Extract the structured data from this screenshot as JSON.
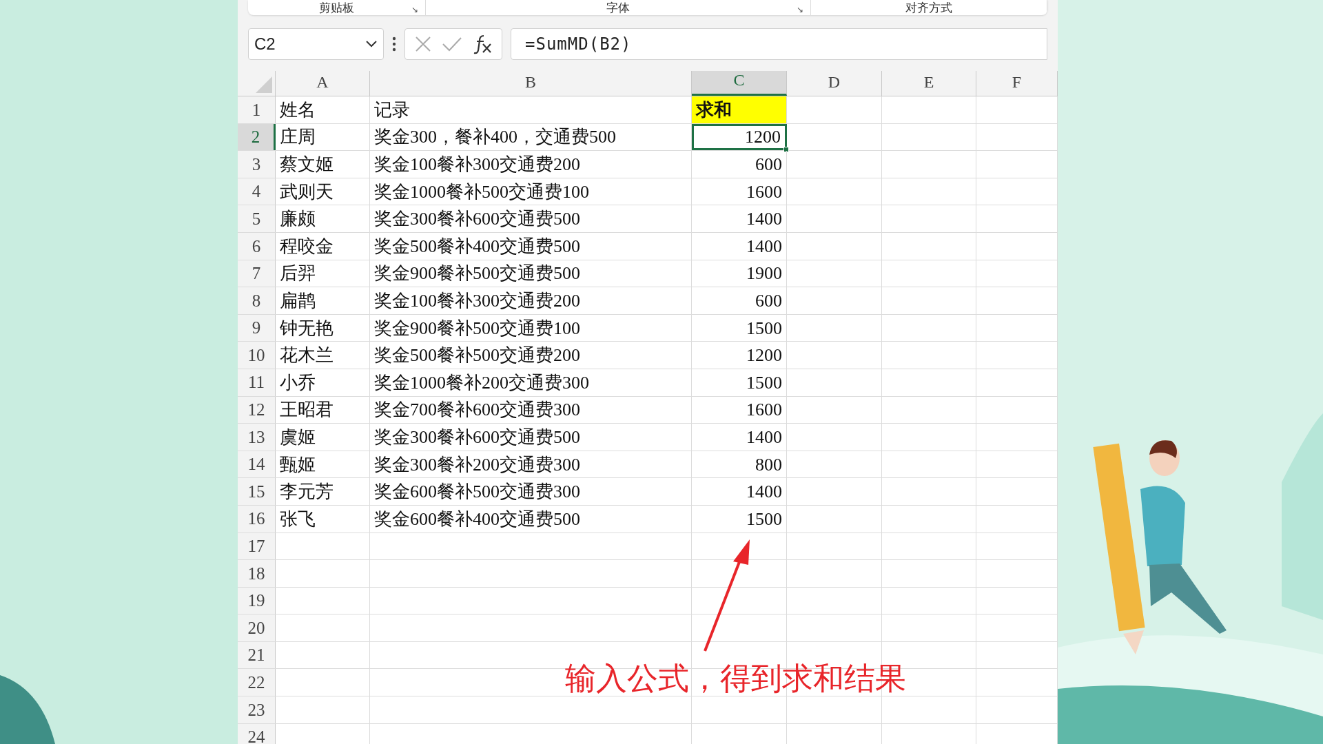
{
  "ribbon_groups": [
    {
      "label": "剪贴板",
      "launcher": "↘"
    },
    {
      "label": "字体",
      "launcher": "↘"
    },
    {
      "label": "对齐方式"
    }
  ],
  "formula_bar": {
    "name_box": "C2",
    "formula": "=SumMD(B2)"
  },
  "table": {
    "columns": [
      {
        "label": "A",
        "selected": false
      },
      {
        "label": "B",
        "selected": false
      },
      {
        "label": "C",
        "selected": true
      },
      {
        "label": "D",
        "selected": false
      },
      {
        "label": "E",
        "selected": false
      },
      {
        "label": "F",
        "selected": false
      }
    ],
    "rows": [
      {
        "header": "1",
        "selected": false,
        "kind": "header",
        "cells": [
          "姓名",
          "记录",
          "求和"
        ]
      },
      {
        "header": "2",
        "selected": true,
        "kind": "data",
        "cells": [
          "庄周",
          "奖金300，餐补400，交通费500",
          "1200"
        ]
      },
      {
        "header": "3",
        "selected": false,
        "kind": "data",
        "cells": [
          "蔡文姬",
          "奖金100餐补300交通费200",
          "600"
        ]
      },
      {
        "header": "4",
        "selected": false,
        "kind": "data",
        "cells": [
          "武则天",
          "奖金1000餐补500交通费100",
          "1600"
        ]
      },
      {
        "header": "5",
        "selected": false,
        "kind": "data",
        "cells": [
          "廉颇",
          "奖金300餐补600交通费500",
          "1400"
        ]
      },
      {
        "header": "6",
        "selected": false,
        "kind": "data",
        "cells": [
          "程咬金",
          "奖金500餐补400交通费500",
          "1400"
        ]
      },
      {
        "header": "7",
        "selected": false,
        "kind": "data",
        "cells": [
          "后羿",
          "奖金900餐补500交通费500",
          "1900"
        ]
      },
      {
        "header": "8",
        "selected": false,
        "kind": "data",
        "cells": [
          "扁鹊",
          "奖金100餐补300交通费200",
          "600"
        ]
      },
      {
        "header": "9",
        "selected": false,
        "kind": "data",
        "cells": [
          "钟无艳",
          "奖金900餐补500交通费100",
          "1500"
        ]
      },
      {
        "header": "10",
        "selected": false,
        "kind": "data",
        "cells": [
          "花木兰",
          "奖金500餐补500交通费200",
          "1200"
        ]
      },
      {
        "header": "11",
        "selected": false,
        "kind": "data",
        "cells": [
          "小乔",
          "奖金1000餐补200交通费300",
          "1500"
        ]
      },
      {
        "header": "12",
        "selected": false,
        "kind": "data",
        "cells": [
          "王昭君",
          "奖金700餐补600交通费300",
          "1600"
        ]
      },
      {
        "header": "13",
        "selected": false,
        "kind": "data",
        "cells": [
          "虞姬",
          "奖金300餐补600交通费500",
          "1400"
        ]
      },
      {
        "header": "14",
        "selected": false,
        "kind": "data",
        "cells": [
          "甄姬",
          "奖金300餐补200交通费300",
          "800"
        ]
      },
      {
        "header": "15",
        "selected": false,
        "kind": "data",
        "cells": [
          "李元芳",
          "奖金600餐补500交通费300",
          "1400"
        ]
      },
      {
        "header": "16",
        "selected": false,
        "kind": "data",
        "cells": [
          "张飞",
          "奖金600餐补400交通费500",
          "1500"
        ]
      },
      {
        "header": "17",
        "selected": false,
        "kind": "data"
      },
      {
        "header": "18",
        "selected": false,
        "kind": "data"
      },
      {
        "header": "19",
        "selected": false,
        "kind": "data"
      },
      {
        "header": "20",
        "selected": false,
        "kind": "data"
      },
      {
        "header": "21",
        "selected": false,
        "kind": "data"
      },
      {
        "header": "22",
        "selected": false,
        "kind": "data"
      },
      {
        "header": "23",
        "selected": false,
        "kind": "data"
      },
      {
        "header": "24",
        "selected": false,
        "kind": "data"
      }
    ]
  },
  "annotation": {
    "text": "输入公式，得到求和结果"
  }
}
